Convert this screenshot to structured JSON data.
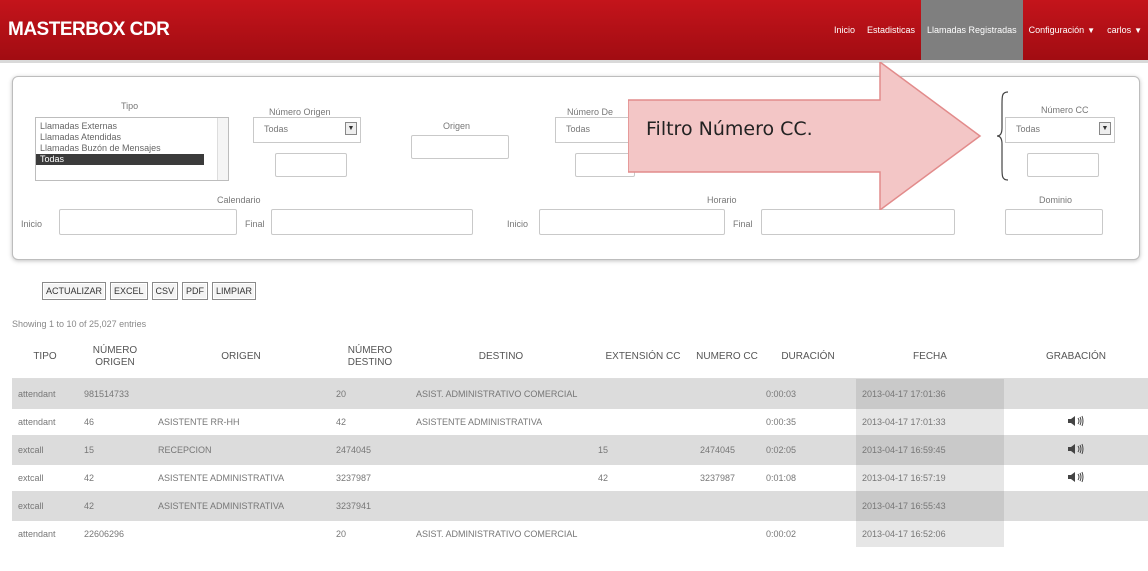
{
  "brand": "MASTERBOX CDR",
  "nav": {
    "items": [
      {
        "label": "Inicio",
        "active": false,
        "caret": false
      },
      {
        "label": "Estadisticas",
        "active": false,
        "caret": false
      },
      {
        "label": "Llamadas Registradas",
        "active": true,
        "caret": false
      },
      {
        "label": "Configuración",
        "active": false,
        "caret": true
      },
      {
        "label": "carlos",
        "active": false,
        "caret": true
      }
    ]
  },
  "filters": {
    "tipo_label": "Tipo",
    "tipo_options": [
      "Llamadas Externas",
      "Llamadas Atendidas",
      "Llamadas Buzón de Mensajes",
      "Todas"
    ],
    "tipo_selected": "Todas",
    "numero_origen_label": "Número Origen",
    "numero_origen_value": "Todas",
    "origen_label": "Origen",
    "numero_destino_label": "Número De",
    "numero_destino_value": "Todas",
    "numero_cc_label": "Número CC",
    "numero_cc_value": "Todas",
    "calendario_label": "Calendario",
    "horario_label": "Horario",
    "dominio_label": "Dominio",
    "inicio_label": "Inicio",
    "final_label": "Final"
  },
  "annotation": {
    "text": "Filtro Número CC.",
    "fill_color": "#f3c6c6",
    "stroke_color": "#e28b8b"
  },
  "buttons": [
    "ACTUALIZAR",
    "EXCEL",
    "CSV",
    "PDF",
    "LIMPIAR"
  ],
  "showing": "Showing 1 to 10 of 25,027 entries",
  "table": {
    "headers": [
      "TIPO",
      "NÚMERO ORIGEN",
      "ORIGEN",
      "NÚMERO DESTINO",
      "DESTINO",
      "EXTENSIÓN CC",
      "NUMERO CC",
      "DURACIÓN",
      "FECHA",
      "GRABACIÓN"
    ],
    "rows": [
      {
        "tipo": "attendant",
        "numero_origen": "981514733",
        "origen": "",
        "numero_destino": "20",
        "destino": "ASIST. ADMINISTRATIVO COMERCIAL",
        "extension_cc": "",
        "numero_cc": "",
        "duracion": "0:00:03",
        "fecha": "2013-04-17 17:01:36",
        "grabacion": false
      },
      {
        "tipo": "attendant",
        "numero_origen": "46",
        "origen": "ASISTENTE RR-HH",
        "numero_destino": "42",
        "destino": "ASISTENTE ADMINISTRATIVA",
        "extension_cc": "",
        "numero_cc": "",
        "duracion": "0:00:35",
        "fecha": "2013-04-17 17:01:33",
        "grabacion": true
      },
      {
        "tipo": "extcall",
        "numero_origen": "15",
        "origen": "RECEPCION",
        "numero_destino": "2474045",
        "destino": "",
        "extension_cc": "15",
        "numero_cc": "2474045",
        "duracion": "0:02:05",
        "fecha": "2013-04-17 16:59:45",
        "grabacion": true
      },
      {
        "tipo": "extcall",
        "numero_origen": "42",
        "origen": "ASISTENTE ADMINISTRATIVA",
        "numero_destino": "3237987",
        "destino": "",
        "extension_cc": "42",
        "numero_cc": "3237987",
        "duracion": "0:01:08",
        "fecha": "2013-04-17 16:57:19",
        "grabacion": true
      },
      {
        "tipo": "extcall",
        "numero_origen": "42",
        "origen": "ASISTENTE ADMINISTRATIVA",
        "numero_destino": "3237941",
        "destino": "",
        "extension_cc": "",
        "numero_cc": "",
        "duracion": "",
        "fecha": "2013-04-17 16:55:43",
        "grabacion": false
      },
      {
        "tipo": "attendant",
        "numero_origen": "22606296",
        "origen": "",
        "numero_destino": "20",
        "destino": "ASIST. ADMINISTRATIVO COMERCIAL",
        "extension_cc": "",
        "numero_cc": "",
        "duracion": "0:00:02",
        "fecha": "2013-04-17 16:52:06",
        "grabacion": false
      }
    ]
  }
}
